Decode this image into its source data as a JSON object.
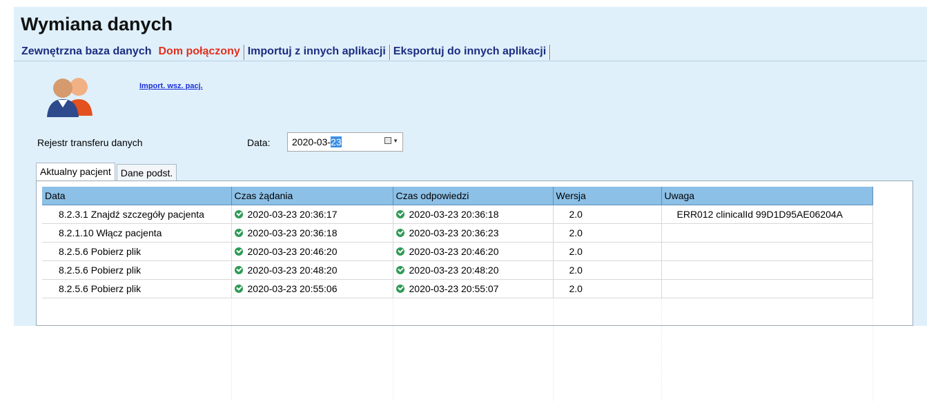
{
  "page": {
    "title": "Wymiana danych"
  },
  "main_tabs": [
    {
      "label": "Zewnętrzna baza danych",
      "active": false
    },
    {
      "label": "Dom połączony",
      "active": true
    },
    {
      "label": "Importuj z innych aplikacji",
      "active": false
    },
    {
      "label": "Eksportuj do innych aplikacji",
      "active": false
    }
  ],
  "import": {
    "link_label": "Import. wsz. pacj."
  },
  "register": {
    "label": "Rejestr transferu danych",
    "date_label": "Data:",
    "date_value_prefix": "2020-03-",
    "date_value_selected": "23"
  },
  "sub_tabs": [
    {
      "label": "Aktualny pacjent",
      "active": true
    },
    {
      "label": "Dane podst.",
      "active": false
    }
  ],
  "table": {
    "columns": [
      "Data",
      "Czas żądania",
      "Czas odpowiedzi",
      "Wersja",
      "Uwaga"
    ],
    "rows": [
      {
        "name": "8.2.3.1 Znajdź szczegóły pacjenta",
        "request": "2020-03-23 20:36:17",
        "response": "2020-03-23 20:36:18",
        "version": "2.0",
        "note": "ERR012 clinicalId 99D1D95AE06204A"
      },
      {
        "name": "8.2.1.10 Włącz pacjenta",
        "request": "2020-03-23 20:36:18",
        "response": "2020-03-23 20:36:23",
        "version": "2.0",
        "note": ""
      },
      {
        "name": "8.2.5.6 Pobierz plik",
        "request": "2020-03-23 20:46:20",
        "response": "2020-03-23 20:46:20",
        "version": "2.0",
        "note": ""
      },
      {
        "name": "8.2.5.6 Pobierz plik",
        "request": "2020-03-23 20:48:20",
        "response": "2020-03-23 20:48:20",
        "version": "2.0",
        "note": ""
      },
      {
        "name": "8.2.5.6 Pobierz plik",
        "request": "2020-03-23 20:55:06",
        "response": "2020-03-23 20:55:07",
        "version": "2.0",
        "note": ""
      }
    ]
  },
  "colors": {
    "panel_bg": "#dff0fb",
    "active_tab": "#e0301e",
    "tab_text": "#1c2c80",
    "header_bg": "#8dc0e6",
    "status_ok": "#2f9b55",
    "link": "#1b2fd8"
  },
  "icons": {
    "avatar": "patients-icon",
    "status": "check-circle-icon",
    "calendar": "calendar-icon"
  }
}
